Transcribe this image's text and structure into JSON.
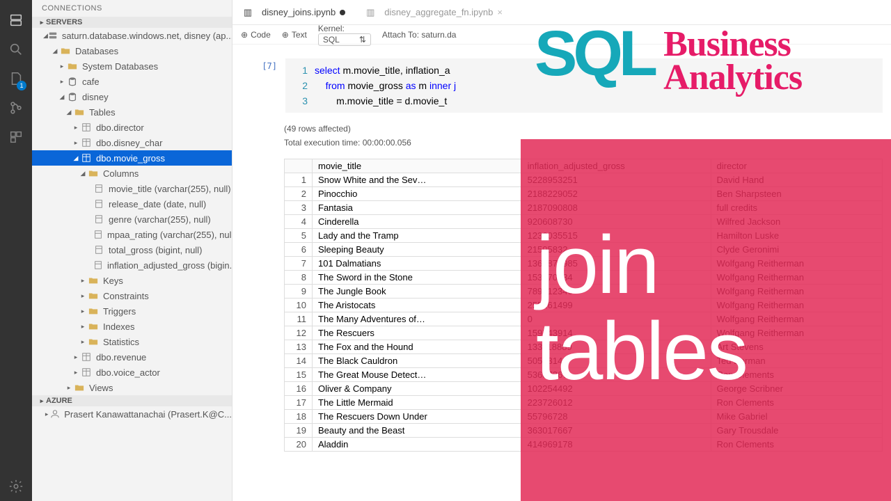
{
  "sidebar": {
    "title": "CONNECTIONS",
    "sections": {
      "servers": "SERVERS",
      "azure": "AZURE"
    },
    "server_node": "saturn.database.windows.net, disney (ap...",
    "databases_label": "Databases",
    "sys_db": "System Databases",
    "cafe": "cafe",
    "disney": "disney",
    "tables_label": "Tables",
    "tables": {
      "director": "dbo.director",
      "disney_char": "dbo.disney_char",
      "movie_gross": "dbo.movie_gross",
      "revenue": "dbo.revenue",
      "voice_actor": "dbo.voice_actor"
    },
    "columns_label": "Columns",
    "columns": {
      "movie_title": "movie_title (varchar(255), null)",
      "release_date": "release_date (date, null)",
      "genre": "genre (varchar(255), null)",
      "mpaa_rating": "mpaa_rating (varchar(255), null)",
      "total_gross": "total_gross (bigint, null)",
      "inflation": "inflation_adjusted_gross (bigin..."
    },
    "folders": {
      "keys": "Keys",
      "constraints": "Constraints",
      "triggers": "Triggers",
      "indexes": "Indexes",
      "statistics": "Statistics"
    },
    "views_label": "Views",
    "azure_account": "Prasert Kanawattanachai (Prasert.K@C..."
  },
  "tabs": {
    "t1": "disney_joins.ipynb",
    "t2": "disney_aggregate_fn.ipynb"
  },
  "toolbar": {
    "code": "Code",
    "text": "Text",
    "kernel_lbl": "Kernel:",
    "kernel_val": "SQL",
    "attach_lbl": "Attach To:",
    "attach_val": "saturn.da"
  },
  "cell": {
    "prompt": "[7]",
    "line1_html": "<span class='ln'>1</span><span class='kw'>select</span> m.movie_title, inflation_a",
    "line2_html": "<span class='ln'>2</span>    <span class='kw'>from</span> movie_gross <span class='kw'>as</span> m <span class='kw'>inner j</span>",
    "line3_html": "<span class='ln'>3</span>        m.movie_title = d.movie_t"
  },
  "exec": {
    "rows": "(49 rows affected)",
    "time": "Total execution time: 00:00:00.056"
  },
  "chart_data": {
    "type": "table",
    "columns": [
      "movie_title",
      "inflation_adjusted_gross",
      "director"
    ],
    "rows": [
      [
        "Snow White and the Sev…",
        "5228953251",
        "David Hand"
      ],
      [
        "Pinocchio",
        "2188229052",
        "Ben Sharpsteen"
      ],
      [
        "Fantasia",
        "2187090808",
        "full credits"
      ],
      [
        "Cinderella",
        "920608730",
        "Wilfred Jackson"
      ],
      [
        "Lady and the Tramp",
        "1236035515",
        "Hamilton Luske"
      ],
      [
        "Sleeping Beauty",
        "21505832",
        "Clyde Geronimi"
      ],
      [
        "101 Dalmatians",
        "1362870985",
        "Wolfgang Reitherman"
      ],
      [
        "The Sword in the Stone",
        "153870834",
        "Wolfgang Reitherman"
      ],
      [
        "The Jungle Book",
        "789612346",
        "Wolfgang Reitherman"
      ],
      [
        "The Aristocats",
        "255161499",
        "Wolfgang Reitherman"
      ],
      [
        "The Many Adventures of…",
        "0",
        "Wolfgang Reitherman"
      ],
      [
        "The Rescuers",
        "159743914",
        "Wolfgang Reitherman"
      ],
      [
        "The Fox and the Hound",
        "133118889",
        "Art Stevens"
      ],
      [
        "The Black Cauldron",
        "50553142",
        "Ted Berman"
      ],
      [
        "The Great Mouse Detect…",
        "53637367",
        "Ron Clements"
      ],
      [
        "Oliver & Company",
        "102254492",
        "George Scribner"
      ],
      [
        "The Little Mermaid",
        "223726012",
        "Ron Clements"
      ],
      [
        "The Rescuers Down Under",
        "55796728",
        "Mike Gabriel"
      ],
      [
        "Beauty and the Beast",
        "363017667",
        "Gary Trousdale"
      ],
      [
        "Aladdin",
        "414969178",
        "Ron Clements"
      ]
    ]
  },
  "overlay": {
    "sql": "SQL",
    "b": "Business",
    "a": "Analytics",
    "join": "join",
    "tables": "tables"
  }
}
